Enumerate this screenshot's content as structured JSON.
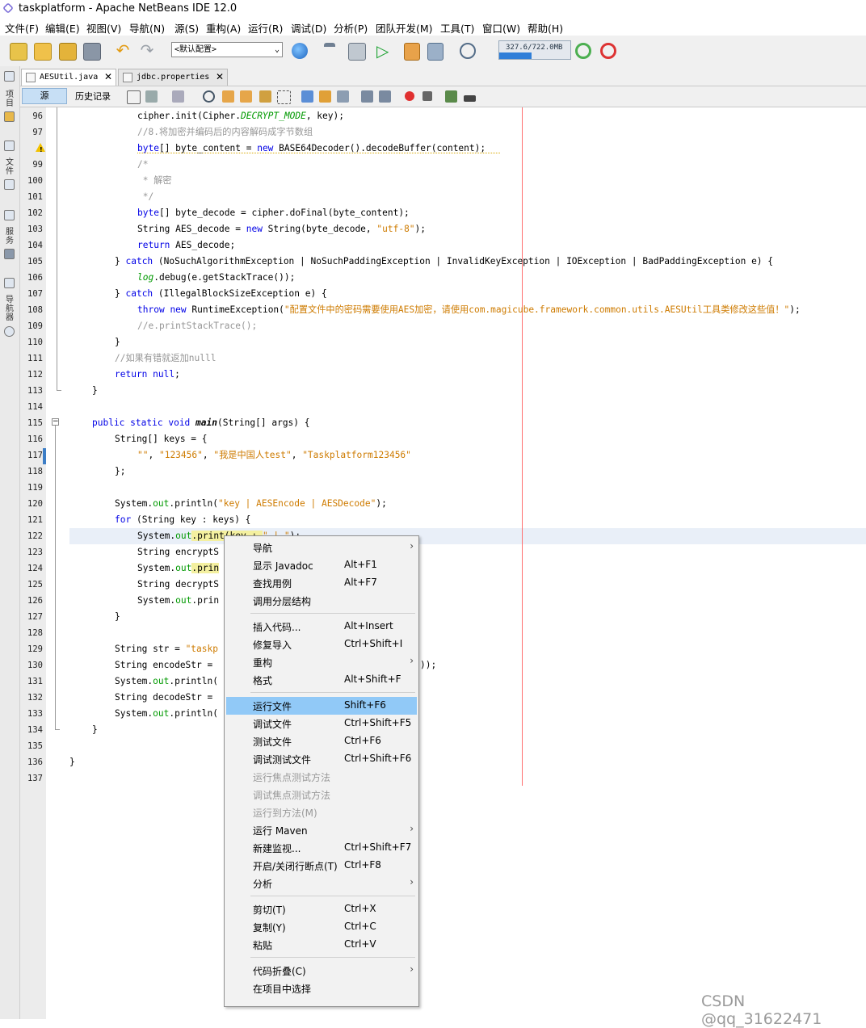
{
  "window": {
    "title": "taskplatform - Apache NetBeans IDE 12.0"
  },
  "menu": [
    "文件(F)",
    "编辑(E)",
    "视图(V)",
    "导航(N)",
    "源(S)",
    "重构(A)",
    "运行(R)",
    "调试(D)",
    "分析(P)",
    "团队开发(M)",
    "工具(T)",
    "窗口(W)",
    "帮助(H)"
  ],
  "toolbar": {
    "config": "<默认配置>",
    "memory": "327.6/722.0MB",
    "memory_fraction": 0.45
  },
  "sidebar": {
    "labels": [
      "项目",
      "文件",
      "服务",
      "导航器"
    ]
  },
  "tabs": [
    {
      "label": "AESUtil.java",
      "active": true
    },
    {
      "label": "jdbc.properties",
      "active": false
    }
  ],
  "editor_toolbar": {
    "source": "源",
    "history": "历史记录"
  },
  "editor": {
    "lines": [
      96,
      97,
      98,
      99,
      100,
      101,
      102,
      103,
      104,
      105,
      106,
      107,
      108,
      109,
      110,
      111,
      112,
      113,
      114,
      115,
      116,
      117,
      118,
      119,
      120,
      121,
      122,
      123,
      124,
      125,
      126,
      127,
      128,
      129,
      130,
      131,
      132,
      133,
      134,
      135,
      136,
      137
    ],
    "warning_line": 98,
    "code": {
      "l96a": "cipher.init(Cipher.",
      "l96b": "DECRYPT_MODE",
      "l96c": ", key);",
      "l97": "//8.将加密并编码后的内容解码成字节数组",
      "l98a": "byte",
      "l98b": "[] byte_content = ",
      "l98c": "new",
      "l98d": " BASE64Decoder().decodeBuffer(content);",
      "l99": "/*",
      "l100": " * 解密",
      "l101": " */",
      "l102a": "byte",
      "l102b": "[] byte_decode = cipher.doFinal(byte_content);",
      "l103a": "String AES_decode = ",
      "l103b": "new",
      "l103c": " String(byte_decode, ",
      "l103d": "\"utf-8\"",
      "l103e": ");",
      "l104a": "return",
      "l104b": " AES_decode;",
      "l105a": "} ",
      "l105b": "catch",
      "l105c": " (NoSuchAlgorithmException | NoSuchPaddingException | InvalidKeyException | IOException | BadPaddingException e) {",
      "l106a": "log",
      "l106b": ".debug(e.getStackTrace());",
      "l107a": "} ",
      "l107b": "catch",
      "l107c": " (IllegalBlockSizeException e) {",
      "l108a": "throw",
      "l108b": " ",
      "l108c": "new",
      "l108d": " RuntimeException(",
      "l108e": "\"配置文件中的密码需要使用AES加密，请使用com.magicube.framework.common.utils.AESUtil工具类修改这些值！\"",
      "l108f": ");",
      "l109": "//e.printStackTrace();",
      "l110": "}",
      "l111": "//如果有错就返加nulll",
      "l112a": "return",
      "l112b": " null",
      "l112c": ";",
      "l113": "}",
      "l115a": "public",
      "l115b": " ",
      "l115c": "static",
      "l115d": " ",
      "l115e": "void",
      "l115f": " ",
      "l115g": "main",
      "l115h": "(String[] args) {",
      "l116": "String[] keys = {",
      "l117a": "\"\"",
      "l117b": ", ",
      "l117c": "\"123456\"",
      "l117d": ", ",
      "l117e": "\"我是中国人test\"",
      "l117f": ", ",
      "l117g": "\"Taskplatform123456\"",
      "l118": "};",
      "l120a": "System.",
      "l120b": "out",
      "l120c": ".println(",
      "l120d": "\"key | AESEncode | AESDecode\"",
      "l120e": ");",
      "l121a": "for",
      "l121b": " (String key : keys) {",
      "l122a": "System.",
      "l122b": "out",
      "l122c": ".print(key + ",
      "l122d": "\" | \"",
      "l122e": ");",
      "l123": "String encryptS",
      "l124a": "System.",
      "l124b": "out",
      "l124c": ".prin",
      "l125": "String decryptS",
      "l126a": "System.",
      "l126b": "out",
      "l126c": ".prin",
      "l127": "}",
      "l129a": "String str = ",
      "l129b": "\"taskp",
      "l130a": "String encodeStr = ",
      "l130b": "));",
      "l131a": "System.",
      "l131b": "out",
      "l131c": ".println(",
      "l132": "String decodeStr = ",
      "l133a": "System.",
      "l133b": "out",
      "l133c": ".println(",
      "l134": "}",
      "l136": "}"
    }
  },
  "context_menu": [
    {
      "label": "导航",
      "shortcut": "",
      "submenu": true
    },
    {
      "label": "显示 Javadoc",
      "shortcut": "Alt+F1"
    },
    {
      "label": "查找用例",
      "shortcut": "Alt+F7"
    },
    {
      "label": "调用分层结构",
      "shortcut": ""
    },
    {
      "label": "插入代码...",
      "shortcut": "Alt+Insert"
    },
    {
      "label": "修复导入",
      "shortcut": "Ctrl+Shift+I"
    },
    {
      "label": "重构",
      "shortcut": "",
      "submenu": true
    },
    {
      "label": "格式",
      "shortcut": "Alt+Shift+F"
    },
    {
      "label": "运行文件",
      "shortcut": "Shift+F6",
      "selected": true
    },
    {
      "label": "调试文件",
      "shortcut": "Ctrl+Shift+F5"
    },
    {
      "label": "测试文件",
      "shortcut": "Ctrl+F6"
    },
    {
      "label": "调试测试文件",
      "shortcut": "Ctrl+Shift+F6"
    },
    {
      "label": "运行焦点测试方法",
      "shortcut": "",
      "disabled": true
    },
    {
      "label": "调试焦点测试方法",
      "shortcut": "",
      "disabled": true
    },
    {
      "label": "运行到方法(M)",
      "shortcut": "",
      "disabled": true
    },
    {
      "label": "运行 Maven",
      "shortcut": "",
      "submenu": true
    },
    {
      "label": "新建监视...",
      "shortcut": "Ctrl+Shift+F7"
    },
    {
      "label": "开启/关闭行断点(T)",
      "shortcut": "Ctrl+F8"
    },
    {
      "label": "分析",
      "shortcut": "",
      "submenu": true
    },
    {
      "label": "剪切(T)",
      "shortcut": "Ctrl+X"
    },
    {
      "label": "复制(Y)",
      "shortcut": "Ctrl+C"
    },
    {
      "label": "粘贴",
      "shortcut": "Ctrl+V"
    },
    {
      "label": "代码折叠(C)",
      "shortcut": "",
      "submenu": true
    },
    {
      "label": "在项目中选择",
      "shortcut": ""
    }
  ],
  "submenu_arrow": "›",
  "watermark": "CSDN @qq_31622471",
  "colors": {
    "accent": "#91c9f7",
    "keyword": "#0000e6",
    "string": "#ce7b00",
    "comment": "#969696",
    "field": "#009900",
    "margin": "#ff6f6f"
  }
}
